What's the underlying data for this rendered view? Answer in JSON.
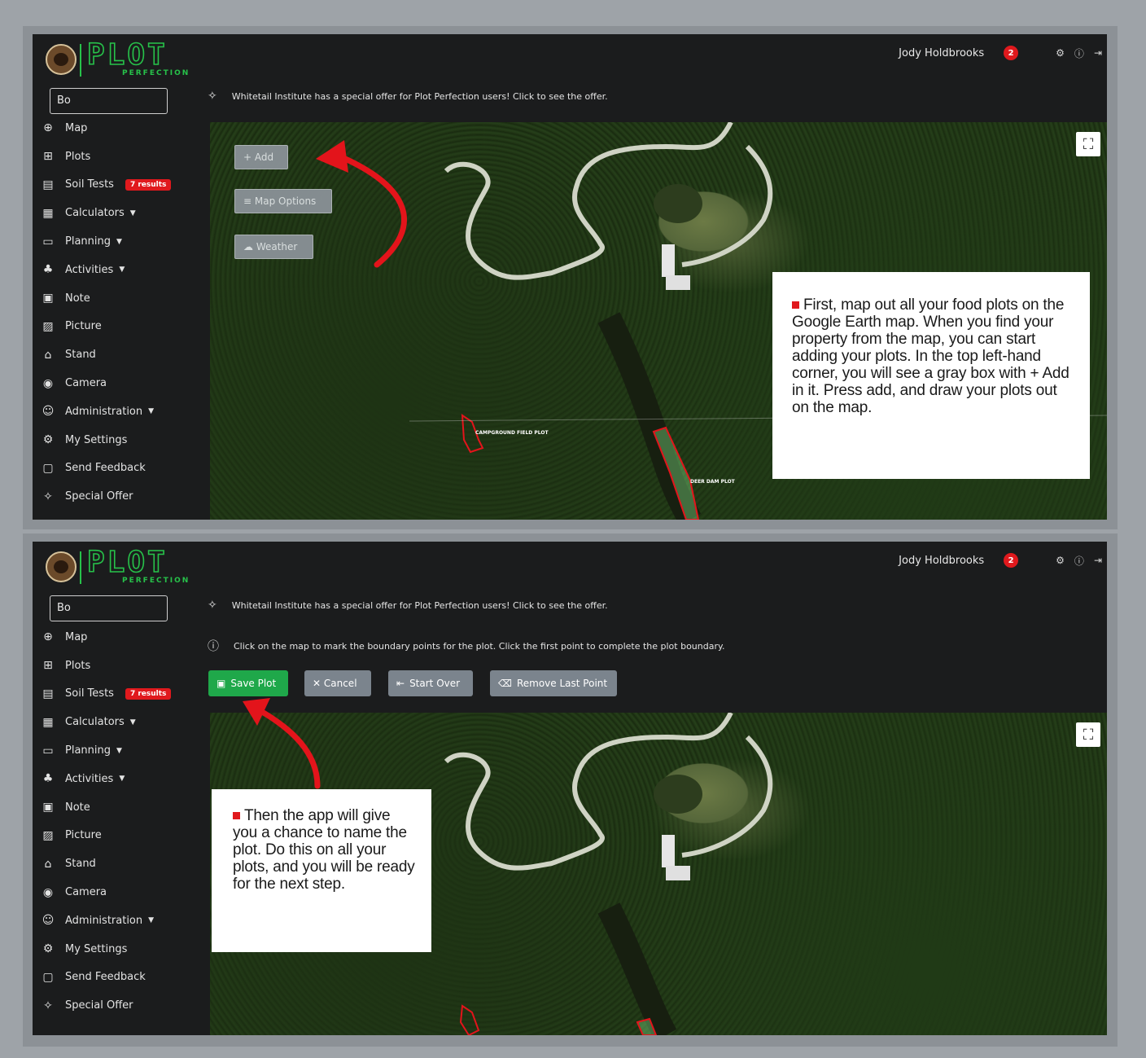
{
  "brand": {
    "name": "PLOT",
    "tagline": "PERFECTION"
  },
  "user": {
    "name": "Jody Holdbrooks",
    "notifications": "2"
  },
  "search": {
    "value": "Bo"
  },
  "offer_text": "Whitetail Institute has a special offer for Plot Perfection users! Click to see the offer.",
  "nav": [
    {
      "label": "Map",
      "icon": "globe-icon",
      "glyph": "⊕"
    },
    {
      "label": "Plots",
      "icon": "plots-icon",
      "glyph": "⊞"
    },
    {
      "label": "Soil Tests",
      "icon": "soil-test-icon",
      "glyph": "▤",
      "badge": "7 results"
    },
    {
      "label": "Calculators",
      "icon": "calculator-icon",
      "glyph": "▦",
      "caret": true
    },
    {
      "label": "Planning",
      "icon": "calendar-icon",
      "glyph": "▭",
      "caret": true
    },
    {
      "label": "Activities",
      "icon": "activities-icon",
      "glyph": "♣",
      "caret": true
    },
    {
      "label": "Note",
      "icon": "note-icon",
      "glyph": "▣"
    },
    {
      "label": "Picture",
      "icon": "picture-icon",
      "glyph": "▨"
    },
    {
      "label": "Stand",
      "icon": "stand-icon",
      "glyph": "⌂"
    },
    {
      "label": "Camera",
      "icon": "camera-icon",
      "glyph": "◉"
    },
    {
      "label": "Administration",
      "icon": "admin-icon",
      "glyph": "☺",
      "caret": true
    },
    {
      "label": "My Settings",
      "icon": "settings-icon",
      "glyph": "⚙"
    },
    {
      "label": "Send Feedback",
      "icon": "feedback-icon",
      "glyph": "▢"
    },
    {
      "label": "Special Offer",
      "icon": "sparkle-icon",
      "glyph": "✧"
    }
  ],
  "panel1": {
    "map_buttons": [
      "+ Add",
      "≡ Map Options",
      "☁ Weather"
    ],
    "plot_labels": [
      "CAMPGROUND FIELD PLOT",
      "DEER DAM PLOT"
    ],
    "caption": "First, map out all your food plots on the Google Earth map. When you find your property from the map, you can start adding your plots. In the top left-hand corner, you will see a gray box with + Add in it. Press add, and draw your plots out on the map."
  },
  "panel2": {
    "info_text": "Click on the map to mark the boundary points for the plot. Click the first point to complete the plot boundary.",
    "buttons": {
      "save": "Save Plot",
      "cancel": "✕ Cancel",
      "start_over": "Start Over",
      "remove_last": "Remove Last Point"
    },
    "caption": "Then the app will give you a chance to name the plot. Do this on all your plots, and you will be ready for the next step."
  },
  "colors": {
    "accent_green": "#27c24a",
    "badge_red": "#e0191d",
    "arrow_red": "#e3141b",
    "save_green": "#1fa84a"
  }
}
